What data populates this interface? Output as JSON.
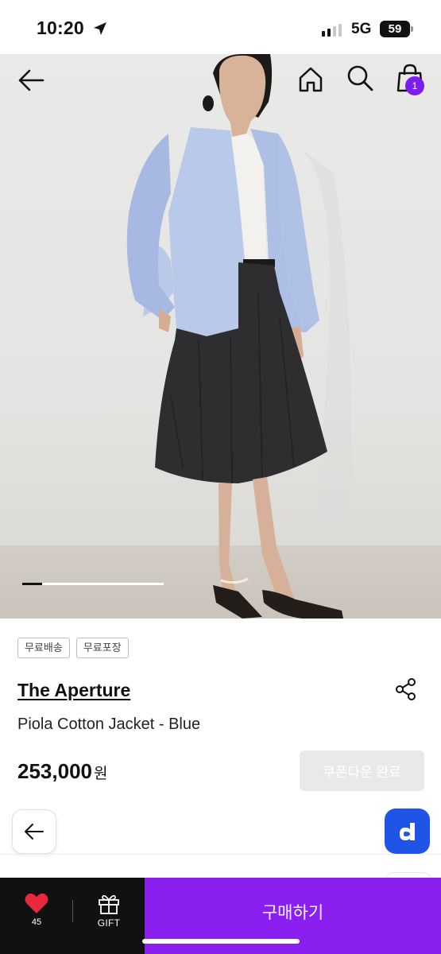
{
  "status_bar": {
    "time": "10:20",
    "network": "5G",
    "battery": "59"
  },
  "hero": {
    "image_index": 1,
    "image_count": 7,
    "cart_count": "1"
  },
  "icons": {
    "back": "arrow-left-icon",
    "home": "home-icon",
    "search": "search-icon",
    "bag": "shopping-bag-icon",
    "share": "share-icon",
    "heart": "heart-icon",
    "gift": "gift-icon",
    "app": "d-logo-icon"
  },
  "product": {
    "tags": [
      "무료배송",
      "무료포장"
    ],
    "brand": "The Aperture",
    "name": "Piola Cotton Jacket - Blue",
    "price": "253,000",
    "price_unit": "원",
    "coupon_label": "쿠폰다운 완료"
  },
  "bottom_bar": {
    "like_count": "45",
    "gift_label": "GIFT",
    "buy_label": "구매하기"
  },
  "colors": {
    "accent": "#8a1ff0",
    "badge": "#7b1cf0",
    "heart": "#e8283c",
    "app_blue": "#1f54e6"
  }
}
